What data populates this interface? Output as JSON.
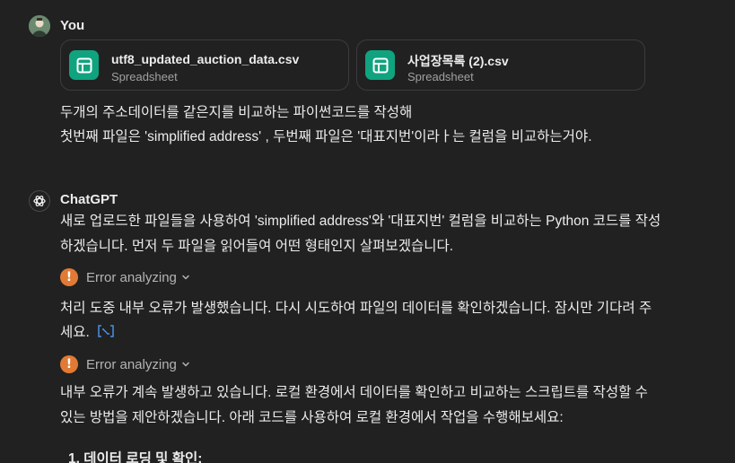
{
  "user_message": {
    "author": "You",
    "attachments": [
      {
        "name": "utf8_updated_auction_data.csv",
        "type": "Spreadsheet",
        "icon": "spreadsheet-icon"
      },
      {
        "name": "사업장목록 (2).csv",
        "type": "Spreadsheet",
        "icon": "spreadsheet-icon"
      }
    ],
    "lines": [
      "두개의 주소데이터를 같은지를 비교하는 파이썬코드를 작성해",
      "첫번째 파일은 'simplified address' , 두번째 파일은 '대표지번'이라ㅏ는 컬럼을 비교하는거야."
    ]
  },
  "assistant_message": {
    "author": "ChatGPT",
    "p1": [
      "새로 업로드한 파일들을 사용하여 'simplified address'와 '대표지번' 컬럼을 비교하는 Python 코드를 작성",
      "하겠습니다. 먼저 두 파일을 읽어들여 어떤 형태인지 살펴보겠습니다."
    ],
    "error1_label": "Error analyzing",
    "p2": [
      "처리 도중 내부 오류가 발생했습니다. 다시 시도하여 파일의 데이터를 확인하겠습니다. 잠시만 기다려 주",
      "세요."
    ],
    "error2_label": "Error analyzing",
    "p3": [
      "내부 오류가 계속 발생하고 있습니다. 로컬 환경에서 데이터를 확인하고 비교하는 스크립트를 작성할 수",
      "있는 방법을 제안하겠습니다. 아래 코드를 사용하여 로컬 환경에서 작업을 수행해보세요:"
    ],
    "list_item_1": "1. 데이터 로딩 및 확인:"
  },
  "colors": {
    "background": "#212121",
    "text": "#ececec",
    "muted": "#a0a0a0",
    "accent_green": "#10a37f",
    "error_orange": "#e07a35",
    "code_link_blue": "#4a90e2"
  }
}
